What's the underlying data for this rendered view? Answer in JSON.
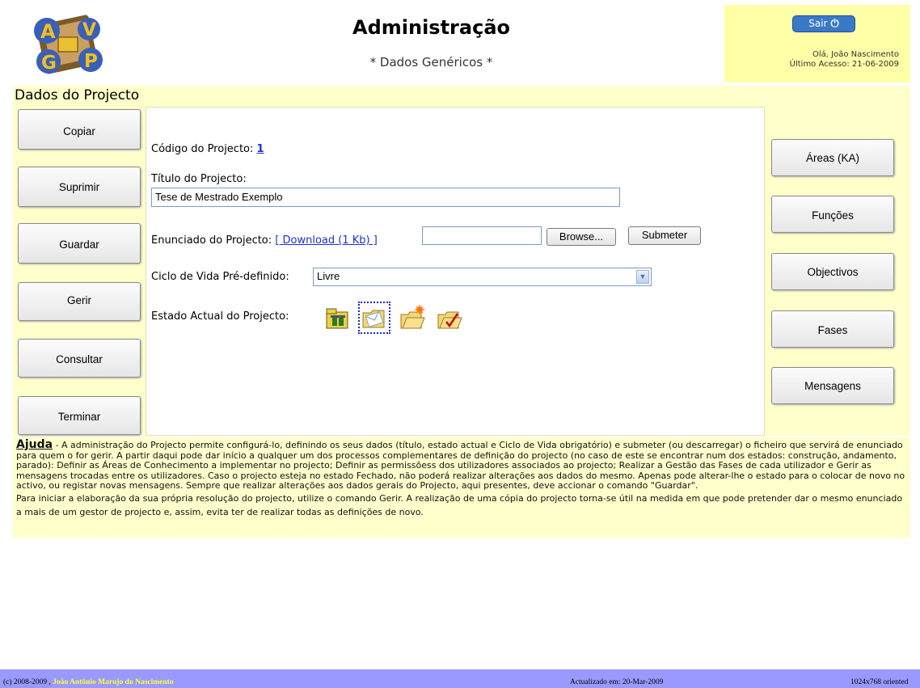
{
  "header": {
    "title": "Administração",
    "subtitle": "* Dados Genéricos *",
    "logout_label": "Sair",
    "greeting": "Olá, João Nascimento",
    "last_access": "Último Acesso: 21-06-2009"
  },
  "section_title": "Dados do Projecto",
  "left_buttons": [
    "Copiar",
    "Suprimir",
    "Guardar",
    "Gerir",
    "Consultar",
    "Terminar"
  ],
  "right_buttons": [
    "Áreas (KA)",
    "Funções",
    "Objectivos",
    "Fases",
    "Mensagens"
  ],
  "form": {
    "code_label": "Código do Projecto:",
    "code_value": "1",
    "title_label": "Título do Projecto:",
    "title_value": "Tese de Mestrado Exemplo",
    "statement_label": "Enunciado do Projecto:",
    "download_link": "[ Download (1 Kb) ]",
    "browse_label": "Browse...",
    "submit_label": "Submeter",
    "lifecycle_label": "Ciclo de Vida Pré-definido:",
    "lifecycle_value": "Livre",
    "state_label": "Estado Actual do Projecto:",
    "state_icons": [
      "construction-state-icon",
      "in-progress-state-icon",
      "new-state-icon",
      "closed-state-icon"
    ]
  },
  "help": {
    "heading": "Ajuda",
    "text1": " - A administração do Projecto permite configurá-lo, definindo os seus dados (título, estado actual e Ciclo de Vida obrigatório) e submeter (ou descarregar) o ficheiro que servirá de enunciado para quem o for gerir. A partir daqui pode dar início a qualquer um dos processos complementares de definição do projecto (no caso de este se encontrar num dos estados: construção, andamento, parado): Definir as Áreas de Conhecimento a implementar no projecto; Definir as permissõess dos utilizadores associados ao projecto; Realizar a Gestão das Fases de cada utilizador e Gerir as mensagens trocadas entre os utilizadores. Caso o projecto esteja no estado Fechado, não poderá realizar alterações aos dados do mesmo. Apenas pode alterar-lhe o estado para o colocar de novo no activo, ou registar novas mensagens. Sempre que realizar alterações aos dados gerais do Projecto, aqui presentes, deve accionar o comando \"Guardar\".",
    "text2": "Para iniciar a elaboração da sua própria resolução do projecto, utilize o comando Gerir. A realização de uma cópia do projecto torna-se útil na medida em que pode pretender dar o mesmo enunciado a mais de um gestor de projecto e, assim, evita ter de realizar todas as definições de novo."
  },
  "footer": {
    "copyright": "(c) 2008-2009 ,",
    "author": "João Antônio Marujo do Nascimento",
    "updated": "Actualizado em: 20-Mar-2009",
    "resolution": "1024x768 oriented"
  },
  "colors": {
    "panel": "#ffffcc",
    "userbox": "#ffffa8",
    "footer": "#9999ff",
    "link": "#1a32d6"
  }
}
